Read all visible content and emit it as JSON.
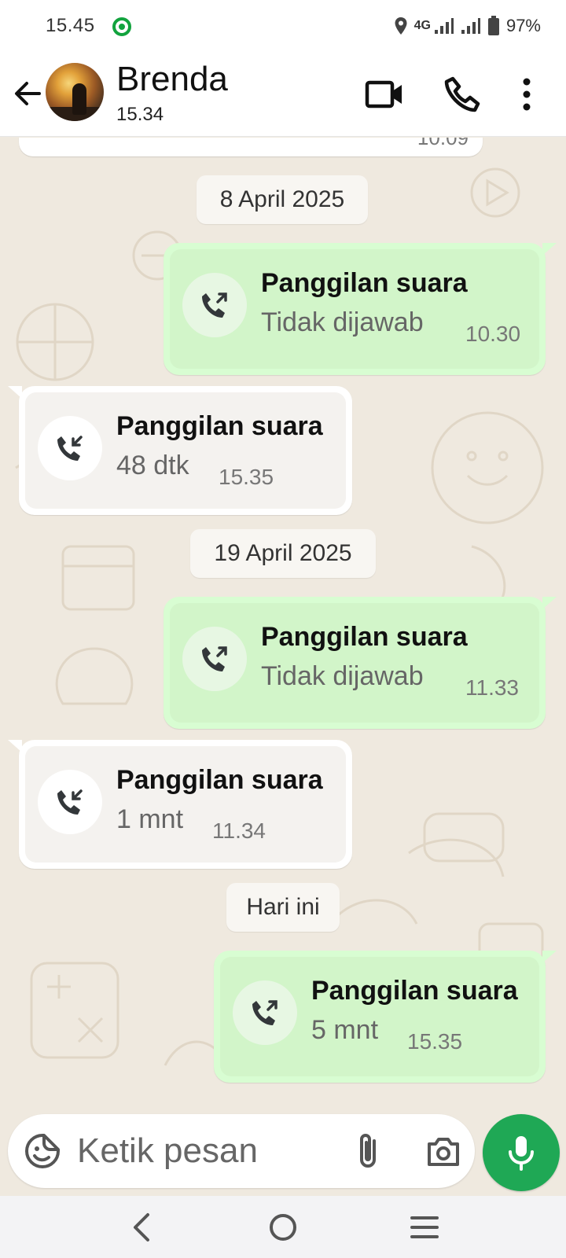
{
  "status_bar": {
    "time": "15.45",
    "network": "4G",
    "battery": "97%"
  },
  "header": {
    "name": "Brenda",
    "status": "15.34"
  },
  "chat": {
    "previous_time": "10.09",
    "date_chips": [
      "8 April 2025",
      "19 April 2025",
      "Hari ini"
    ],
    "calls": [
      {
        "direction": "outgoing",
        "title": "Panggilan suara",
        "detail": "Tidak dijawab",
        "time": "10.30"
      },
      {
        "direction": "incoming",
        "title": "Panggilan suara",
        "detail": "48 dtk",
        "time": "15.35"
      },
      {
        "direction": "outgoing",
        "title": "Panggilan suara",
        "detail": "Tidak dijawab",
        "time": "11.33"
      },
      {
        "direction": "incoming",
        "title": "Panggilan suara",
        "detail": "1 mnt",
        "time": "11.34"
      },
      {
        "direction": "outgoing",
        "title": "Panggilan suara",
        "detail": "5 mnt",
        "time": "15.35"
      }
    ]
  },
  "input": {
    "placeholder": "Ketik pesan"
  },
  "icons": {
    "back": "arrow-left-icon",
    "video": "video-call-icon",
    "call": "phone-icon",
    "more": "more-vertical-icon",
    "outgoing_call": "outgoing-call-icon",
    "incoming_call": "incoming-call-icon",
    "emoji": "sticker-icon",
    "attach": "paperclip-icon",
    "camera": "camera-icon",
    "mic": "mic-icon"
  },
  "colors": {
    "outgoing_bubble": "#d8fdd2",
    "incoming_bubble": "#ffffff",
    "chat_background": "#efe9df",
    "mic_button": "#1fa855",
    "status_dot": "#12a33e"
  }
}
